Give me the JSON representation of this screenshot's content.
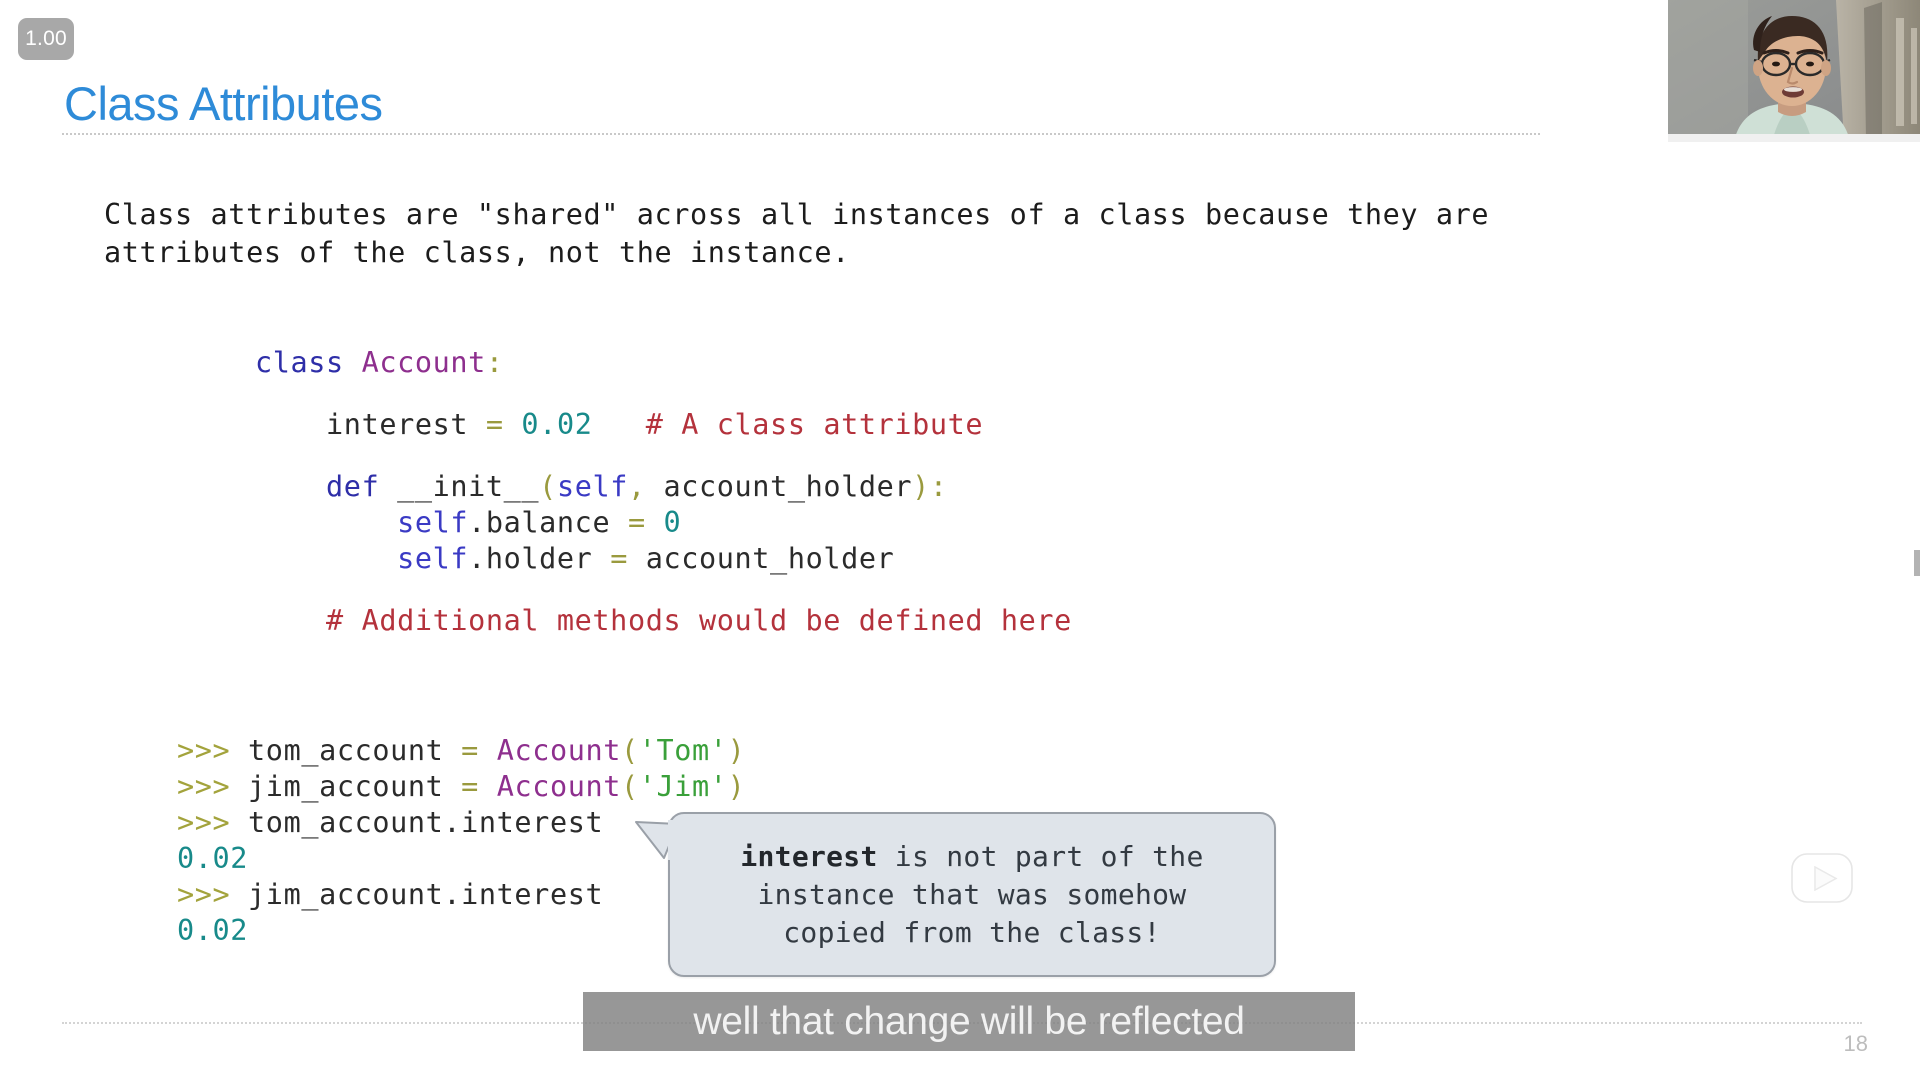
{
  "player": {
    "speed_badge": "1.00",
    "watermark_icon": "tv-play-icon"
  },
  "slide": {
    "title": "Class Attributes",
    "page_number": "18",
    "title_color": "#2e8bd8",
    "body_text": "Class attributes are \"shared\" across all instances of a class because they are\nattributes of the class, not the instance.",
    "code_lines": [
      {
        "indent": 0,
        "tokens": [
          {
            "t": "class",
            "c": "tok-kw"
          },
          {
            "t": " ",
            "c": "tok-plain"
          },
          {
            "t": "Account",
            "c": "tok-cls"
          },
          {
            "t": ":",
            "c": "tok-punc"
          }
        ]
      },
      {
        "gap": true
      },
      {
        "indent": 4,
        "tokens": [
          {
            "t": "interest",
            "c": "tok-name"
          },
          {
            "t": " ",
            "c": "tok-plain"
          },
          {
            "t": "=",
            "c": "tok-op"
          },
          {
            "t": " ",
            "c": "tok-plain"
          },
          {
            "t": "0.02",
            "c": "tok-num"
          },
          {
            "t": "   ",
            "c": "tok-plain"
          },
          {
            "t": "# A class attribute",
            "c": "tok-cmt"
          }
        ]
      },
      {
        "gap": true
      },
      {
        "indent": 4,
        "tokens": [
          {
            "t": "def",
            "c": "tok-kw"
          },
          {
            "t": " ",
            "c": "tok-plain"
          },
          {
            "t": "__init__",
            "c": "tok-name"
          },
          {
            "t": "(",
            "c": "tok-punc"
          },
          {
            "t": "self",
            "c": "tok-self"
          },
          {
            "t": ",",
            "c": "tok-punc"
          },
          {
            "t": " ",
            "c": "tok-plain"
          },
          {
            "t": "account_holder",
            "c": "tok-name"
          },
          {
            "t": "):",
            "c": "tok-punc"
          }
        ]
      },
      {
        "indent": 8,
        "tokens": [
          {
            "t": "self",
            "c": "tok-self"
          },
          {
            "t": ".",
            "c": "tok-plain"
          },
          {
            "t": "balance",
            "c": "tok-name"
          },
          {
            "t": " ",
            "c": "tok-plain"
          },
          {
            "t": "=",
            "c": "tok-op"
          },
          {
            "t": " ",
            "c": "tok-plain"
          },
          {
            "t": "0",
            "c": "tok-num"
          }
        ]
      },
      {
        "indent": 8,
        "tokens": [
          {
            "t": "self",
            "c": "tok-self"
          },
          {
            "t": ".",
            "c": "tok-plain"
          },
          {
            "t": "holder",
            "c": "tok-name"
          },
          {
            "t": " ",
            "c": "tok-plain"
          },
          {
            "t": "=",
            "c": "tok-op"
          },
          {
            "t": " ",
            "c": "tok-plain"
          },
          {
            "t": "account_holder",
            "c": "tok-name"
          }
        ]
      },
      {
        "gap": true
      },
      {
        "indent": 4,
        "tokens": [
          {
            "t": "# Additional methods would be defined here",
            "c": "tok-cmt"
          }
        ]
      }
    ],
    "repl_lines": [
      {
        "tokens": [
          {
            "t": ">>>",
            "c": "tok-prompt"
          },
          {
            "t": " ",
            "c": "tok-plain"
          },
          {
            "t": "tom_account",
            "c": "tok-name"
          },
          {
            "t": " ",
            "c": "tok-plain"
          },
          {
            "t": "=",
            "c": "tok-op"
          },
          {
            "t": " ",
            "c": "tok-plain"
          },
          {
            "t": "Account",
            "c": "tok-cls"
          },
          {
            "t": "(",
            "c": "tok-punc"
          },
          {
            "t": "'Tom'",
            "c": "tok-str"
          },
          {
            "t": ")",
            "c": "tok-punc"
          }
        ]
      },
      {
        "tokens": [
          {
            "t": ">>>",
            "c": "tok-prompt"
          },
          {
            "t": " ",
            "c": "tok-plain"
          },
          {
            "t": "jim_account",
            "c": "tok-name"
          },
          {
            "t": " ",
            "c": "tok-plain"
          },
          {
            "t": "=",
            "c": "tok-op"
          },
          {
            "t": " ",
            "c": "tok-plain"
          },
          {
            "t": "Account",
            "c": "tok-cls"
          },
          {
            "t": "(",
            "c": "tok-punc"
          },
          {
            "t": "'Jim'",
            "c": "tok-str"
          },
          {
            "t": ")",
            "c": "tok-punc"
          }
        ]
      },
      {
        "tokens": [
          {
            "t": ">>>",
            "c": "tok-prompt"
          },
          {
            "t": " ",
            "c": "tok-plain"
          },
          {
            "t": "tom_account.interest",
            "c": "tok-name"
          }
        ]
      },
      {
        "tokens": [
          {
            "t": "0.02",
            "c": "tok-out"
          }
        ]
      },
      {
        "tokens": [
          {
            "t": ">>>",
            "c": "tok-prompt"
          },
          {
            "t": " ",
            "c": "tok-plain"
          },
          {
            "t": "jim_account.interest",
            "c": "tok-name"
          }
        ]
      },
      {
        "tokens": [
          {
            "t": "0.02",
            "c": "tok-out"
          }
        ]
      }
    ],
    "callout": {
      "bold_word": "interest",
      "rest_line1": " is not part of the",
      "line2": "instance that was somehow",
      "line3": "copied from the class!",
      "background": "#dfe4ea",
      "border": "#9aa0a8"
    }
  },
  "caption": {
    "text": "well that change will be reflected",
    "background": "rgba(128,128,128,0.82)",
    "color": "#f2f2f2"
  }
}
